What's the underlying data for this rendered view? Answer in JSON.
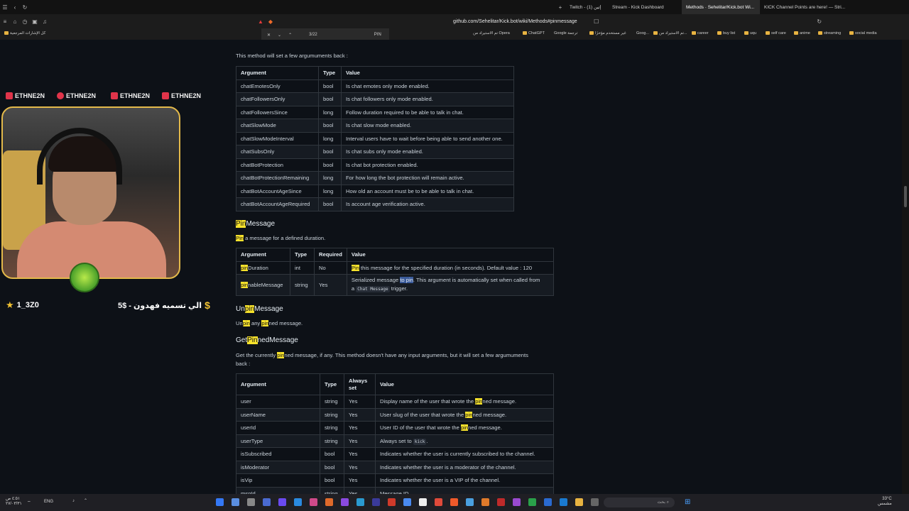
{
  "tabs": [
    {
      "label": "Twitch - (1) إتين"
    },
    {
      "label": "Stream - Kick Dashboard"
    },
    {
      "label": "Methods · Sehelitar/Kick.bot Wi..."
    },
    {
      "label": "KICK Channel Points are here! — Stri..."
    }
  ],
  "address": {
    "url": "github.com/Sehelitar/Kick.bot/wiki/Methods#pinmessage"
  },
  "find": {
    "count": "3/22",
    "query": "PIN"
  },
  "bookmarks": [
    {
      "label": "كل الإشارات المرجعية"
    },
    {
      "label": "social media"
    },
    {
      "label": "streaming"
    },
    {
      "label": "anime"
    },
    {
      "label": "self care"
    },
    {
      "label": "uqu"
    },
    {
      "label": "buy list"
    },
    {
      "label": "career"
    },
    {
      "label": "تم الاستيراد من..."
    },
    {
      "label": "Goog..."
    },
    {
      "label": "غير مستخدم مؤخرًا"
    },
    {
      "label": "Google ترجمة"
    },
    {
      "label": "ChatGPT"
    },
    {
      "label": "تم الاستيراد من Opera"
    }
  ],
  "overlay": {
    "social_handles": [
      "ETHNE2N",
      "ETHNE2N",
      "ETHNE2N",
      "ETHNE2N"
    ],
    "donor": "1_3Z0",
    "donation": "الي تسميه فهدون - $5"
  },
  "page": {
    "intro": "This method will set a few argumuments back :",
    "table1": {
      "headers": [
        "Argument",
        "Type",
        "Value"
      ],
      "rows": [
        [
          "chatEmotesOnly",
          "bool",
          "Is chat emotes only mode enabled."
        ],
        [
          "chatFollowersOnly",
          "bool",
          "Is chat followers only mode enabled."
        ],
        [
          "chatFollowersSince",
          "long",
          "Follow duration required to be able to talk in chat."
        ],
        [
          "chatSlowMode",
          "bool",
          "Is chat slow mode enabled."
        ],
        [
          "chatSlowModeInterval",
          "long",
          "Interval users have to wait before being able to send another one."
        ],
        [
          "chatSubsOnly",
          "bool",
          "Is chat subs only mode enabled."
        ],
        [
          "chatBotProtection",
          "bool",
          "Is chat bot protection enabled."
        ],
        [
          "chatBotProtectionRemaining",
          "long",
          "For how long the bot protection will remain active."
        ],
        [
          "chatBotAccountAgeSince",
          "long",
          "How old an account must be to be able to talk in chat."
        ],
        [
          "chatBotAccountAgeRequired",
          "bool",
          "Is account age verification active."
        ]
      ]
    },
    "pin": {
      "title_hl": "Pin",
      "title_rest": "Message",
      "desc_hl": "Pin",
      "desc_rest": " a message for a defined duration.",
      "headers": [
        "Argument",
        "Type",
        "Required",
        "Value"
      ],
      "row1": {
        "arg_hl": "pin",
        "arg_rest": "Duration",
        "type": "int",
        "required": "No",
        "val_hl": "Pin",
        "val_rest": " this message for the specified duration (in seconds). Default value : 120"
      },
      "row2": {
        "arg_hl": "pin",
        "arg_rest": "nableMessage",
        "type": "string",
        "required": "Yes",
        "val_a": "Serialized message ",
        "val_sel1": "to ",
        "val_sel2": "pin",
        "val_b": ". This argument is automatically set when called from",
        "val_c": "a ",
        "val_code": "Chat Message",
        "val_d": " trigger."
      }
    },
    "unpin": {
      "title_a": "Un",
      "title_hl": "pin",
      "title_b": "Message",
      "desc_a": "Un",
      "desc_hl1": "pin",
      "desc_b": " any ",
      "desc_hl2": "pin",
      "desc_c": "ned message."
    },
    "getpinned": {
      "title_a": "Get",
      "title_hl": "Pin",
      "title_b": "nedMessage",
      "desc_a": "Get the currently ",
      "desc_hl": "pin",
      "desc_b": "ned message, if any. This method doesn't have any input arguments, but it will set a few argumuments",
      "desc_c": "back :",
      "headers": [
        "Argument",
        "Type",
        "Always set",
        "Value"
      ],
      "rows": [
        {
          "arg": "user",
          "type": "string",
          "always": "Yes",
          "v_a": "Display name of the user that wrote the ",
          "v_hl": "pin",
          "v_b": "ned message."
        },
        {
          "arg": "userName",
          "type": "string",
          "always": "Yes",
          "v_a": "User slug of the user that wrote the ",
          "v_hl": "pin",
          "v_b": "ned message."
        },
        {
          "arg": "userId",
          "type": "string",
          "always": "Yes",
          "v_a": "User ID of the user that wrote the ",
          "v_hl": "pin",
          "v_b": "ned message."
        },
        {
          "arg": "userType",
          "type": "string",
          "always": "Yes",
          "v_a": "Always set to ",
          "v_code": "kick",
          "v_b": "."
        },
        {
          "arg": "isSubscribed",
          "type": "bool",
          "always": "Yes",
          "v_a": "Indicates whether the user is currently subscribed to the channel."
        },
        {
          "arg": "isModerator",
          "type": "bool",
          "always": "Yes",
          "v_a": "Indicates whether the user is a moderator of the channel."
        },
        {
          "arg": "isVip",
          "type": "bool",
          "always": "Yes",
          "v_a": "Indicates whether the user is a VIP of the channel."
        },
        {
          "arg": "msgId",
          "type": "string",
          "always": "Yes",
          "v_a": "Message ID"
        }
      ]
    }
  },
  "taskbar": {
    "lang": "ENG",
    "weather_temp": "33°C",
    "weather_text": "مشمس",
    "search_placeholder": "بحث",
    "clock_time": "٤:٥١ ص",
    "clock_date": "٢٧/٠٣/٣١"
  },
  "colors": {
    "highlight": "#f7e22c",
    "selection": "#3a5a9a",
    "border": "#30363d",
    "frame": "#e3b94a"
  }
}
